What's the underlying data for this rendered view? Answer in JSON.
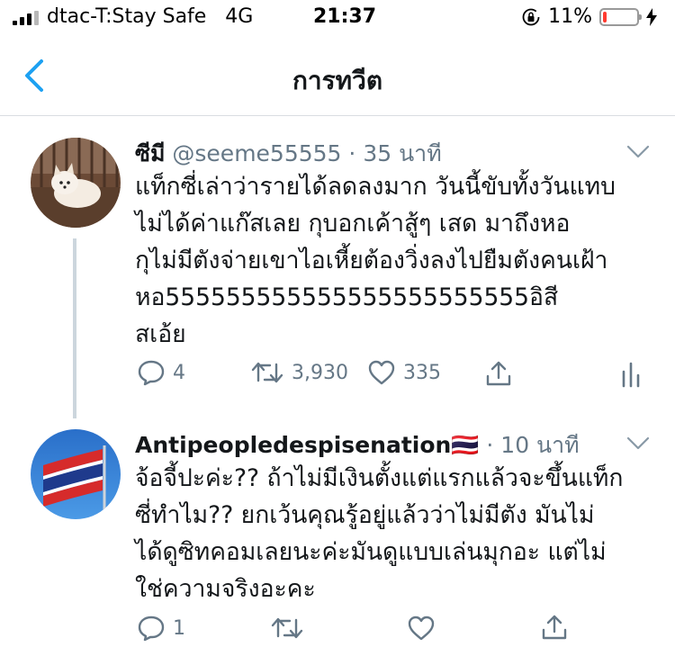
{
  "status_bar": {
    "carrier": "dtac-T:Stay Safe   4G",
    "time": "21:37",
    "battery": "11%",
    "battery_level": 0.11
  },
  "header": {
    "title": "การทวีต"
  },
  "tweets": [
    {
      "name": "ซีมี",
      "handle": "@seeme55555",
      "dot": "·",
      "time": "35 นาที",
      "text": "แท็กซี่เล่าว่ารายได้ลดลงมาก วันนี้ขับทั้งวันแทบ\nไม่ได้ค่าแก๊สเลย กุบอกเค้าสู้ๆ เสด มาถึงหอ\nกุไม่มีตังจ่ายเขาไอเหี้ยต้องวิ่งลงไปยืมตังคนเฝ้า\nหอ555555555555555555555555อิสี\nสเอ้ย",
      "replies": "4",
      "retweets": "3,930",
      "likes": "335"
    },
    {
      "name": "Antipeopledespisenation🇹🇭",
      "dot": "·",
      "time": "10 นาที",
      "text": "จ้อจี้ปะค่ะ?? ถ้าไม่มีเงินตั้งแต่แรกแล้วจะขึ้นแท็ก\nซี่ทำไม?? ยกเว้นคุณรู้อยู่แล้วว่าไม่มีตัง มันไม่\nได้ดูซิทคอมเลยนะค่ะมันดูแบบเล่นมุกอะ แต่ไม่\nใช่ความจริงอะคะ",
      "replies": "1"
    }
  ],
  "icons": {
    "reply": "speech-bubble-icon",
    "retweet": "retweet-arrows-icon",
    "like": "heart-icon",
    "share": "share-upload-icon",
    "analytics": "bar-chart-icon"
  },
  "colors": {
    "accent": "#1da1f2",
    "muted": "#657786",
    "battery_low": "#ff3b30"
  }
}
